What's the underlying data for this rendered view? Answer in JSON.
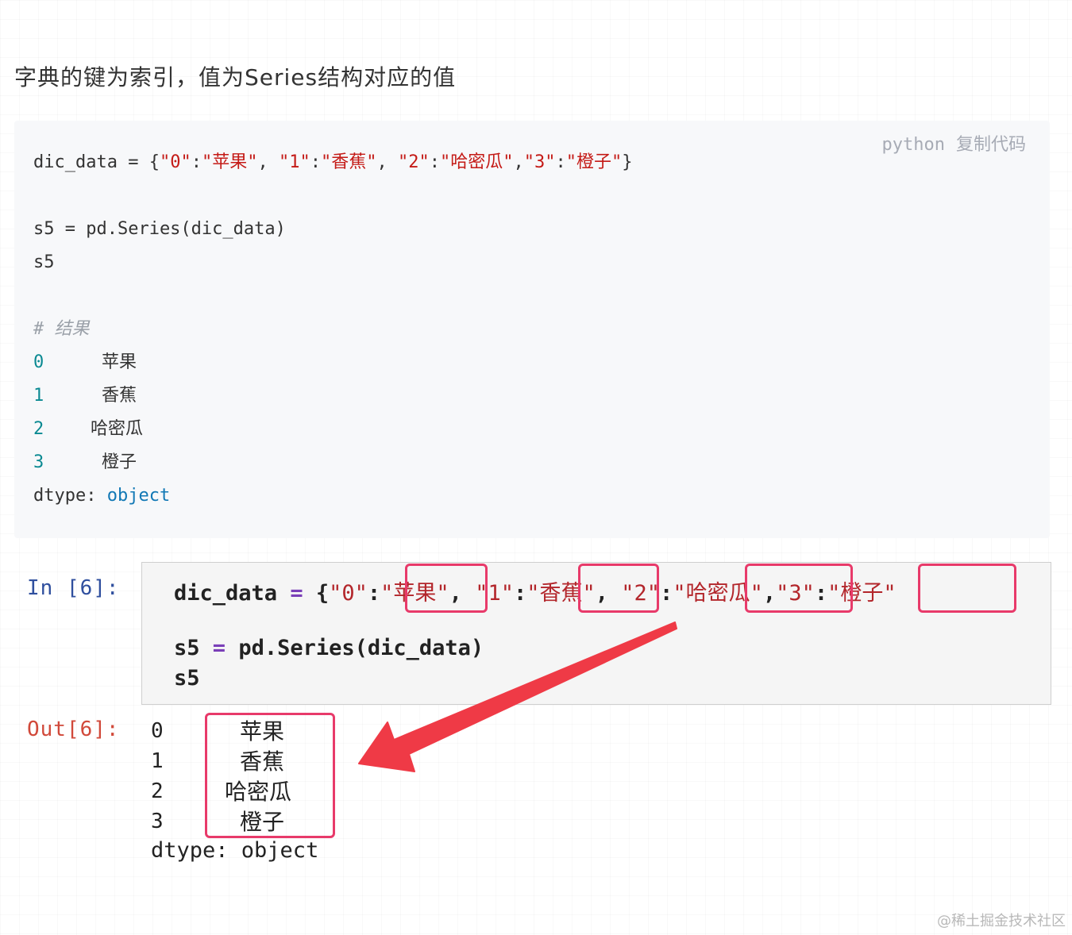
{
  "intro": "字典的键为索引，值为Series结构对应的值",
  "code_block": {
    "language": "python",
    "copy_label": "复制代码",
    "line1_prefix": "dic_data = {",
    "line1_k0": "\"0\"",
    "line1_v0": "\"苹果\"",
    "line1_k1": "\"1\"",
    "line1_v1": "\"香蕉\"",
    "line1_k2": "\"2\"",
    "line1_v2": "\"哈密瓜\"",
    "line1_k3": "\"3\"",
    "line1_v3": "\"橙子\"",
    "line2": "s5 = pd.Series(dic_data)",
    "line3": "s5",
    "comment": "# 结果",
    "results": [
      {
        "index": "0",
        "value": "苹果"
      },
      {
        "index": "1",
        "value": "香蕉"
      },
      {
        "index": "2",
        "value": "哈密瓜"
      },
      {
        "index": "3",
        "value": "橙子"
      }
    ],
    "dtype_label": "dtype:",
    "dtype_value": "object"
  },
  "notebook": {
    "in_prompt": "In [6]:",
    "out_prompt": "Out[6]:",
    "cell_line1_a": "dic_data",
    "cell_line1_op": "=",
    "cell_line1_b": "{",
    "cell_k0": "\"0\"",
    "cell_v0": "\"苹果\"",
    "cell_k1": "\"1\"",
    "cell_v1": "\"香蕉\"",
    "cell_k2": "\"2\"",
    "cell_v2": "\"哈密瓜\"",
    "cell_k3": "\"3\"",
    "cell_v3": "\"橙子\"",
    "cell_line2_a": "s5",
    "cell_line2_op": "=",
    "cell_line2_b": "pd.Series(dic_data)",
    "cell_line3": "s5",
    "output": [
      {
        "index": "0",
        "value": "苹果"
      },
      {
        "index": "1",
        "value": "香蕉"
      },
      {
        "index": "2",
        "value": "哈密瓜"
      },
      {
        "index": "3",
        "value": "橙子"
      }
    ],
    "dtype": "dtype: object"
  },
  "colors": {
    "highlight": "#e83a6a",
    "arrow": "#ef3a46",
    "string": "#c41a16",
    "index_number": "#0b8a92"
  },
  "watermark": "@稀土掘金技术社区"
}
